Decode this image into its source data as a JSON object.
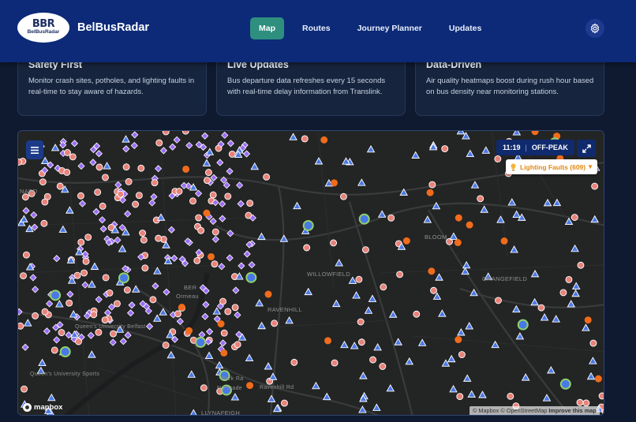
{
  "header": {
    "logo_mark": "BBR",
    "logo_text": "BelBusRadar",
    "brand": "BelBusRadar",
    "nav": [
      {
        "label": "Map",
        "active": true
      },
      {
        "label": "Routes",
        "active": false
      },
      {
        "label": "Journey Planner",
        "active": false
      },
      {
        "label": "Updates",
        "active": false
      }
    ],
    "settings_icon": "gear-icon"
  },
  "cards": [
    {
      "title": "Safety First",
      "text": "Monitor crash sites, potholes, and lighting faults in real-time to stay aware of hazards."
    },
    {
      "title": "Live Updates",
      "text": "Bus departure data refreshes every 15 seconds with real-time delay information from Translink."
    },
    {
      "title": "Data-Driven",
      "text": "Air quality heatmaps boost during rush hour based on bus density near monitoring stations."
    }
  ],
  "map": {
    "time": "11:19",
    "period": "OFF-PEAK",
    "layer": "Lighting Faults (609)",
    "mapbox_label": "mapbox",
    "attribution": {
      "a": "© Mapbox",
      "b": "© OpenStreetMap",
      "c": "Improve this map"
    },
    "labels": {
      "orangefield": "ORANGEFIELD",
      "willowfield": "WILLOWFIELD",
      "ravenhill": "RAVENHILL",
      "qub": "Queen's University Belfast",
      "qu_sports": "Queen's University Sports",
      "park_ra": "Park Ra",
      "n_parade": "N Parade",
      "ravenhill_rd": "Ravenhill Rd",
      "ballynafeigh": "LLYNAFEIGH",
      "bloom": "BLOOM",
      "ormeau": "Ormeau",
      "beer": "BER",
      "nard": "NARD"
    },
    "colors": {
      "bus_stop": "#4a78e6",
      "hazard": "#e8837a",
      "lighting": "#9a6cf5",
      "pothole": "#f06c1c",
      "station": "#8fd06a"
    },
    "icons": [
      "menu-icon",
      "expand-icon",
      "bulb-icon",
      "bus-stop-icon",
      "hazard-icon",
      "lighting-fault-icon",
      "pothole-icon"
    ]
  }
}
